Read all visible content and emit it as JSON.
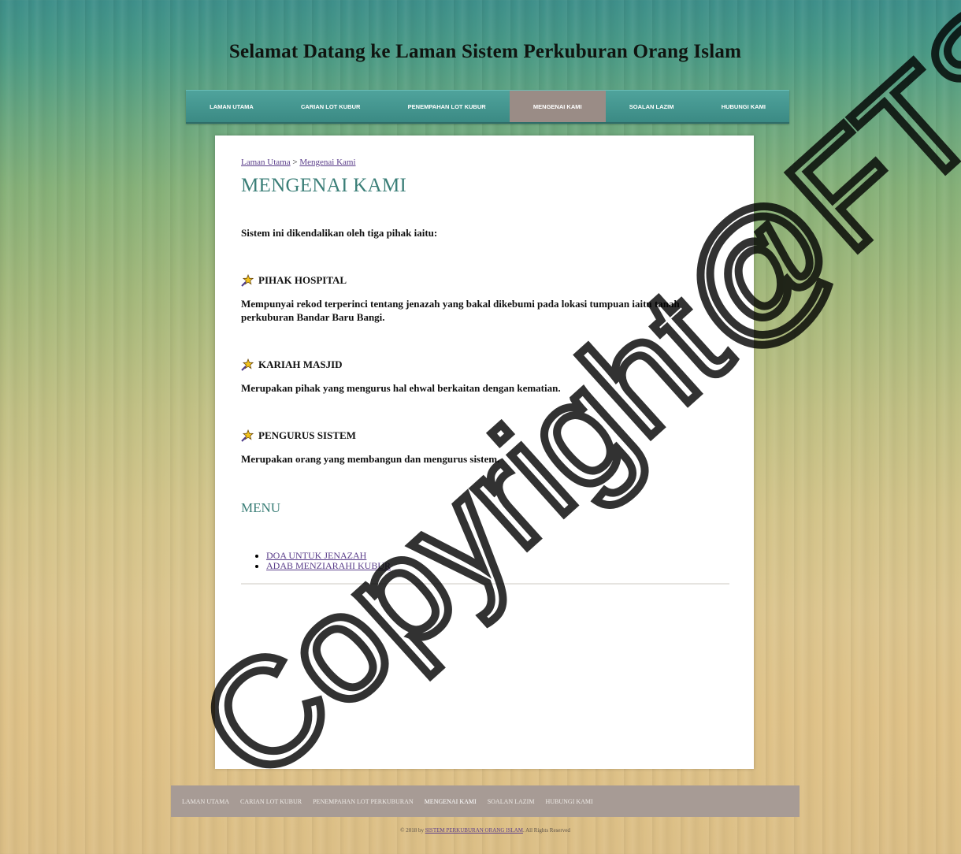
{
  "site": {
    "title": "Selamat Datang ke Laman Sistem Perkuburan Orang Islam"
  },
  "top_nav": {
    "items": [
      {
        "label": "LAMAN UTAMA",
        "active": false
      },
      {
        "label": "CARIAN LOT KUBUR",
        "active": false
      },
      {
        "label": "PENEMPAHAN LOT KUBUR",
        "active": false
      },
      {
        "label": "MENGENAI KAMI",
        "active": true
      },
      {
        "label": "SOALAN LAZIM",
        "active": false
      },
      {
        "label": "HUBUNGI KAMI",
        "active": false
      }
    ]
  },
  "breadcrumb": {
    "home": "Laman Utama",
    "separator": ">",
    "current": "Mengenai Kami"
  },
  "page": {
    "title": "MENGENAI KAMI",
    "intro": "Sistem ini dikendalikan oleh tiga pihak iaitu:",
    "sections": [
      {
        "heading": "PIHAK HOSPITAL",
        "description": "Mempunyai rekod terperinci tentang jenazah yang bakal dikebumi pada lokasi tumpuan iaitu tanah perkuburan Bandar Baru Bangi.",
        "icon": "star-wand-icon"
      },
      {
        "heading": "KARIAH MASJID",
        "description": "Merupakan pihak yang mengurus hal ehwal berkaitan dengan kematian.",
        "icon": "star-wand-icon"
      },
      {
        "heading": "PENGURUS SISTEM",
        "description": "Merupakan orang yang membangun dan mengurus sistem.",
        "icon": "star-wand-icon"
      }
    ],
    "menu_title": "MENU",
    "menu_links": [
      "DOA UNTUK JENAZAH",
      "ADAB MENZIARAHI KUBUR"
    ]
  },
  "footer": {
    "items": [
      {
        "label": "LAMAN UTAMA",
        "active": false
      },
      {
        "label": "CARIAN LOT KUBUR",
        "active": false
      },
      {
        "label": "PENEMPAHAN LOT PERKUBURAN",
        "active": false
      },
      {
        "label": "MENGENAI KAMI",
        "active": true
      },
      {
        "label": "SOALAN LAZIM",
        "active": false
      },
      {
        "label": "HUBUNGI KAMI",
        "active": false
      }
    ],
    "copyright_prefix": "© 2018 by",
    "copyright_link": "SISTEM PERKUBURAN ORANG ISLAM",
    "copyright_suffix": ". All Rights Reserved"
  },
  "watermark": {
    "text": "Copyright@FTSM"
  },
  "colors": {
    "nav_bg": "#3f8f89",
    "nav_active_bg": "#9a8c86",
    "heading_teal": "#3a7e77",
    "link_purple": "#5a3d8a",
    "footer_bg": "#a79b95"
  }
}
